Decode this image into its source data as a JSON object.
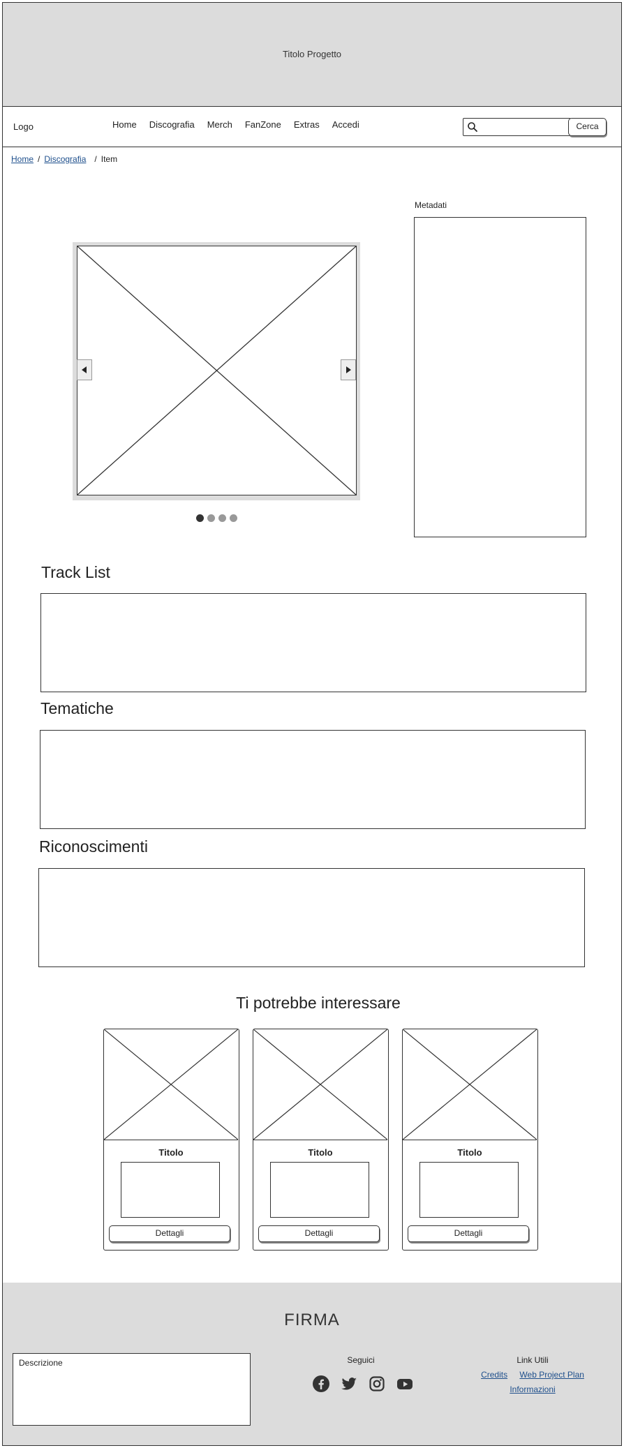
{
  "header": {
    "title": "Titolo Progetto"
  },
  "navbar": {
    "logo": "Logo",
    "links": [
      "Home",
      "Discografia",
      "Merch",
      "FanZone",
      "Extras",
      "Accedi"
    ],
    "search": {
      "placeholder": "",
      "button_label": "Cerca"
    }
  },
  "breadcrumb": {
    "items": [
      "Home",
      "Discografia",
      "Item"
    ],
    "separator": "/"
  },
  "carousel": {
    "slide_count": 4,
    "active_index": 0
  },
  "metadata": {
    "label": "Metadati"
  },
  "sections": {
    "tracklist": "Track List",
    "tematiche": "Tematiche",
    "riconoscimenti": "Riconoscimenti"
  },
  "recommendations": {
    "title": "Ti potrebbe interessare",
    "cards": [
      {
        "title": "Titolo",
        "button": "Dettagli"
      },
      {
        "title": "Titolo",
        "button": "Dettagli"
      },
      {
        "title": "Titolo",
        "button": "Dettagli"
      }
    ]
  },
  "footer": {
    "signature": "FIRMA",
    "description_label": "Descrizione",
    "follow_label": "Seguici",
    "social_icons": [
      "facebook-icon",
      "twitter-icon",
      "instagram-icon",
      "youtube-icon"
    ],
    "links_title": "Link Utili",
    "links": [
      "Credits",
      "Web Project Plan",
      "Informazioni"
    ]
  },
  "colors": {
    "header_bg": "#dcdcdc",
    "border": "#333333",
    "link": "#1e4f8c"
  }
}
